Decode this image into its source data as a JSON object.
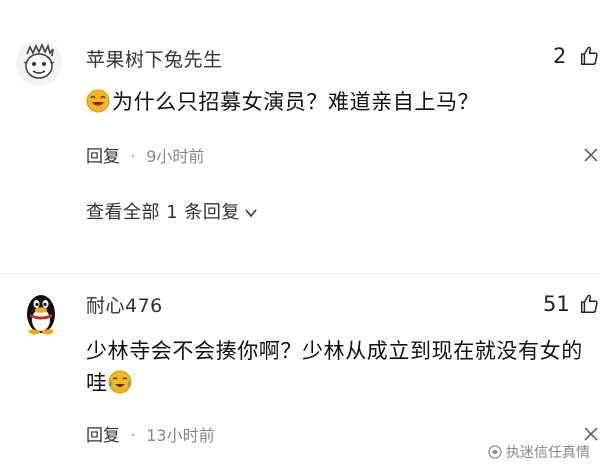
{
  "comments": [
    {
      "username": "苹果树下兔先生",
      "likes": "2",
      "text": "为什么只招募女演员？难道亲自上马？",
      "reply_label": "回复",
      "separator": "·",
      "time": "9小时前",
      "view_all": "查看全部 1 条回复",
      "avatar_icon": "cartoon-avatar-icon",
      "emoji": "laughing-emoji-icon"
    },
    {
      "username": "耐心476",
      "likes": "51",
      "text": "少林寺会不会揍你啊？少林从成立到现在就没有女的哇",
      "reply_label": "回复",
      "separator": "·",
      "time": "13小时前",
      "avatar_icon": "penguin-avatar-icon",
      "emoji": "crying-laughing-emoji-icon"
    }
  ],
  "watermark": "执迷信任真情",
  "colors": {
    "text": "#111111",
    "meta": "#888888",
    "divider": "#ececec",
    "emoji": "#f5b81c"
  }
}
